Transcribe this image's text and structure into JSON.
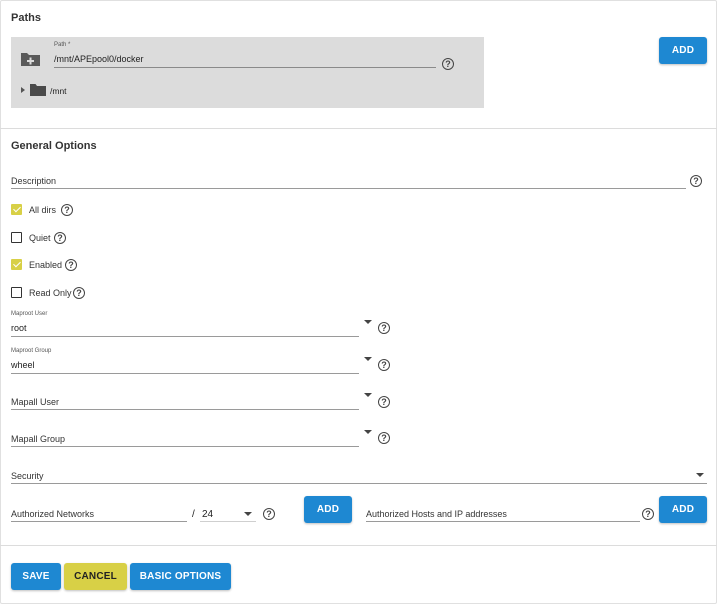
{
  "paths": {
    "title": "Paths",
    "path_label": "Path *",
    "path_value": "/mnt/APEpool0/docker",
    "tree_item": "/mnt",
    "add_label": "ADD"
  },
  "general": {
    "title": "General Options",
    "description_label": "Description",
    "checkboxes": [
      {
        "label": "All dirs",
        "checked": true
      },
      {
        "label": "Quiet",
        "checked": false
      },
      {
        "label": "Enabled",
        "checked": true
      },
      {
        "label": "Read Only",
        "checked": false
      }
    ],
    "maproot_user": {
      "label": "Maproot User",
      "value": "root"
    },
    "maproot_group": {
      "label": "Maproot Group",
      "value": "wheel"
    },
    "mapall_user": {
      "label": "Mapall User"
    },
    "mapall_group": {
      "label": "Mapall Group"
    },
    "security": {
      "label": "Security"
    },
    "networks": {
      "label": "Authorized Networks",
      "slash": "/",
      "mask": "24",
      "add_label": "ADD"
    },
    "hosts": {
      "label": "Authorized Hosts and IP addresses",
      "add_label": "ADD"
    }
  },
  "actions": {
    "save": "SAVE",
    "cancel": "CANCEL",
    "basic": "BASIC OPTIONS"
  },
  "help_glyph": "?",
  "colors": {
    "primary": "#1e88d2",
    "accent": "#d8d046",
    "panel": "#dcdcdc"
  }
}
